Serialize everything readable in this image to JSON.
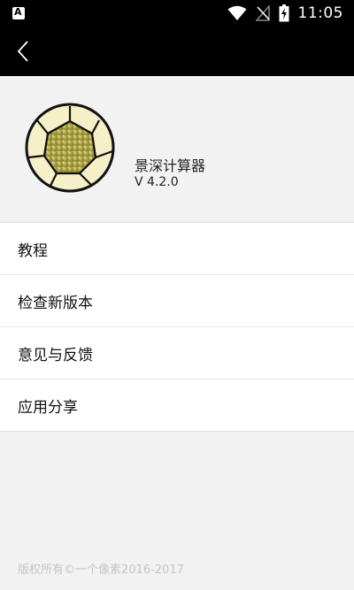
{
  "status_bar": {
    "time": "11:05",
    "icons": [
      "app-notification-icon",
      "wifi-icon",
      "no-signal-icon",
      "battery-charging-icon"
    ]
  },
  "app_bar": {
    "back_icon": "chevron-left-icon"
  },
  "app_info": {
    "name": "景深计算器",
    "version": "V 4.2.0",
    "logo_icon": "aperture-logo-icon"
  },
  "menu": {
    "items": [
      {
        "label": "教程"
      },
      {
        "label": "检查新版本"
      },
      {
        "label": "意见与反馈"
      },
      {
        "label": "应用分享"
      }
    ]
  },
  "footer": {
    "copyright": "版权所有©一个像素2016-2017"
  },
  "colors": {
    "bar_background": "#000000",
    "page_background": "#f2f2f2",
    "menu_background": "#ffffff",
    "footer_text": "#c4c4c4"
  }
}
